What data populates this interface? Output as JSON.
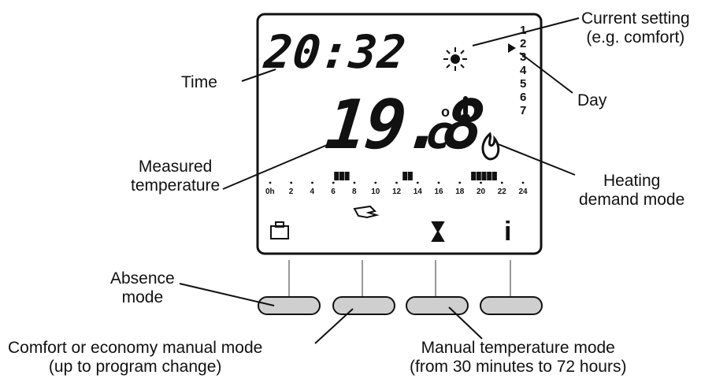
{
  "display": {
    "time": "20:32",
    "temperature": "19.8",
    "unit": "c",
    "degree_symbol": "o",
    "days": [
      "1",
      "2",
      "3",
      "4",
      "5",
      "6",
      "7"
    ],
    "active_day_index": 1,
    "hours": [
      "0h",
      "2",
      "4",
      "6",
      "8",
      "10",
      "12",
      "14",
      "16",
      "18",
      "20",
      "22",
      "24"
    ],
    "program_bar_slots": [
      6.0,
      6.5,
      7.0,
      12.5,
      13.0,
      19.0,
      19.5,
      20.0,
      20.5,
      21.0
    ],
    "info_symbol": "i",
    "icons": [
      "briefcase-icon",
      "hand-icon",
      "hourglass-icon",
      "info-icon",
      "sun-icon",
      "thermometer-icon",
      "flame-icon"
    ]
  },
  "labels": {
    "current_setting": [
      "Current setting",
      "(e.g. comfort)"
    ],
    "time": [
      "Time"
    ],
    "day": [
      "Day"
    ],
    "measured_temperature": [
      "Measured",
      "temperature"
    ],
    "heating_demand": [
      "Heating",
      "demand mode"
    ],
    "absence": [
      "Absence",
      "mode"
    ],
    "comfort_manual": [
      "Comfort or economy manual mode",
      "(up to program change)"
    ],
    "manual_temperature": [
      "Manual temperature mode",
      "(from 30 minutes to 72 hours)"
    ]
  },
  "colors": {
    "button_fill": "#cfcfcf",
    "ink": "#111111"
  }
}
